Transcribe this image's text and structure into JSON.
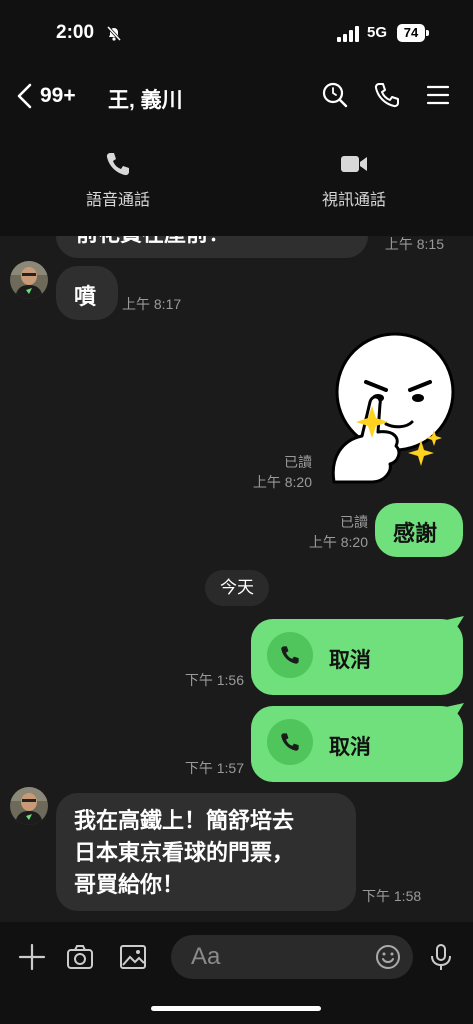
{
  "status_bar": {
    "time": "2:00",
    "network": "5G",
    "battery": "74"
  },
  "header": {
    "unread_count": "99+",
    "title": "王, 義川"
  },
  "call_bar": {
    "voice_label": "語音通話",
    "video_label": "視訊通話"
  },
  "chat": {
    "messages": [
      {
        "type": "incoming",
        "text": "前花費在屋前！",
        "time": "上午 8:15"
      },
      {
        "type": "incoming",
        "text": "噴",
        "time": "上午 8:17"
      },
      {
        "type": "sticker",
        "read": "已讀",
        "time": "上午 8:20"
      },
      {
        "type": "outgoing",
        "text": "感謝",
        "read": "已讀",
        "time": "上午 8:20"
      },
      {
        "type": "call",
        "text": "取消",
        "time": "下午 1:56"
      },
      {
        "type": "call",
        "text": "取消",
        "time": "下午 1:57"
      },
      {
        "type": "incoming",
        "lines": [
          "我在高鐵上！簡舒培去",
          "日本東京看球的門票，",
          "哥買給你！"
        ],
        "time": "下午 1:58"
      }
    ],
    "date_divider": "今天"
  },
  "input_bar": {
    "placeholder": "Aa"
  },
  "colors": {
    "accent_green": "#6fe07b",
    "call_circle": "#4fc55b",
    "incoming_bubble": "#2f2f2f",
    "background": "#1b1b1b"
  },
  "icons": [
    "bell-off-icon",
    "signal-icon",
    "back-icon",
    "search-icon",
    "phone-icon",
    "menu-icon",
    "video-icon",
    "plus-icon",
    "camera-icon",
    "image-icon",
    "emoji-icon",
    "mic-icon"
  ]
}
